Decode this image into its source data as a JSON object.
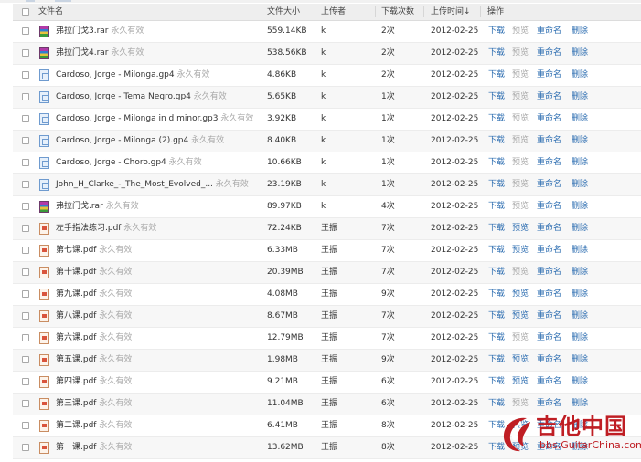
{
  "header": {
    "name": "文件名",
    "size": "文件大小",
    "uploader": "上传者",
    "downloads": "下载次数",
    "time": "上传时间↓",
    "actions": "操作"
  },
  "actions": {
    "download": "下载",
    "preview": "预览",
    "rename": "重命名",
    "delete": "删除"
  },
  "files": [
    {
      "name": "弗拉门戈3.rar",
      "perm": "永久有效",
      "size": "559.14KB",
      "uploader": "k",
      "downloads": "2次",
      "date": "2012-02-25",
      "type": "rar",
      "preview_enabled": false
    },
    {
      "name": "弗拉门戈4.rar",
      "perm": "永久有效",
      "size": "538.56KB",
      "uploader": "k",
      "downloads": "2次",
      "date": "2012-02-25",
      "type": "rar",
      "preview_enabled": false
    },
    {
      "name": "Cardoso, Jorge - Milonga.gp4",
      "perm": "永久有效",
      "size": "4.86KB",
      "uploader": "k",
      "downloads": "2次",
      "date": "2012-02-25",
      "type": "gp4",
      "preview_enabled": false
    },
    {
      "name": "Cardoso, Jorge - Tema Negro.gp4",
      "perm": "永久有效",
      "size": "5.65KB",
      "uploader": "k",
      "downloads": "1次",
      "date": "2012-02-25",
      "type": "gp4",
      "preview_enabled": false
    },
    {
      "name": "Cardoso, Jorge - Milonga in d minor.gp3",
      "perm": "永久有效",
      "size": "3.92KB",
      "uploader": "k",
      "downloads": "1次",
      "date": "2012-02-25",
      "type": "gp4",
      "preview_enabled": false
    },
    {
      "name": "Cardoso, Jorge - Milonga (2).gp4",
      "perm": "永久有效",
      "size": "8.40KB",
      "uploader": "k",
      "downloads": "1次",
      "date": "2012-02-25",
      "type": "gp4",
      "preview_enabled": false
    },
    {
      "name": "Cardoso, Jorge - Choro.gp4",
      "perm": "永久有效",
      "size": "10.66KB",
      "uploader": "k",
      "downloads": "1次",
      "date": "2012-02-25",
      "type": "gp4",
      "preview_enabled": false
    },
    {
      "name": "John_H_Clarke_-_The_Most_Evolved_...",
      "perm": "永久有效",
      "size": "23.19KB",
      "uploader": "k",
      "downloads": "1次",
      "date": "2012-02-25",
      "type": "gp4",
      "preview_enabled": false
    },
    {
      "name": "弗拉门戈.rar",
      "perm": "永久有效",
      "size": "89.97KB",
      "uploader": "k",
      "downloads": "4次",
      "date": "2012-02-25",
      "type": "rar",
      "preview_enabled": false
    },
    {
      "name": "左手指法练习.pdf",
      "perm": "永久有效",
      "size": "72.24KB",
      "uploader": "王振",
      "downloads": "7次",
      "date": "2012-02-25",
      "type": "pdf",
      "preview_enabled": true
    },
    {
      "name": "第七课.pdf",
      "perm": "永久有效",
      "size": "6.33MB",
      "uploader": "王振",
      "downloads": "7次",
      "date": "2012-02-25",
      "type": "pdf",
      "preview_enabled": true
    },
    {
      "name": "第十课.pdf",
      "perm": "永久有效",
      "size": "20.39MB",
      "uploader": "王振",
      "downloads": "7次",
      "date": "2012-02-25",
      "type": "pdf",
      "preview_enabled": false
    },
    {
      "name": "第九课.pdf",
      "perm": "永久有效",
      "size": "4.08MB",
      "uploader": "王振",
      "downloads": "9次",
      "date": "2012-02-25",
      "type": "pdf",
      "preview_enabled": true
    },
    {
      "name": "第八课.pdf",
      "perm": "永久有效",
      "size": "8.67MB",
      "uploader": "王振",
      "downloads": "7次",
      "date": "2012-02-25",
      "type": "pdf",
      "preview_enabled": true
    },
    {
      "name": "第六课.pdf",
      "perm": "永久有效",
      "size": "12.79MB",
      "uploader": "王振",
      "downloads": "7次",
      "date": "2012-02-25",
      "type": "pdf",
      "preview_enabled": false
    },
    {
      "name": "第五课.pdf",
      "perm": "永久有效",
      "size": "1.98MB",
      "uploader": "王振",
      "downloads": "9次",
      "date": "2012-02-25",
      "type": "pdf",
      "preview_enabled": true
    },
    {
      "name": "第四课.pdf",
      "perm": "永久有效",
      "size": "9.21MB",
      "uploader": "王振",
      "downloads": "6次",
      "date": "2012-02-25",
      "type": "pdf",
      "preview_enabled": true
    },
    {
      "name": "第三课.pdf",
      "perm": "永久有效",
      "size": "11.04MB",
      "uploader": "王振",
      "downloads": "6次",
      "date": "2012-02-25",
      "type": "pdf",
      "preview_enabled": false
    },
    {
      "name": "第二课.pdf",
      "perm": "永久有效",
      "size": "6.41MB",
      "uploader": "王振",
      "downloads": "8次",
      "date": "2012-02-25",
      "type": "pdf",
      "preview_enabled": true
    },
    {
      "name": "第一课.pdf",
      "perm": "永久有效",
      "size": "13.62MB",
      "uploader": "王振",
      "downloads": "8次",
      "date": "2012-02-25",
      "type": "pdf",
      "preview_enabled": true
    }
  ],
  "watermark": {
    "text": "吉他中国",
    "url": "bbs.GuitarChina.com"
  },
  "colors": {
    "link": "#2b6cb0",
    "disabled_link": "#a7a7a7",
    "logo_red": "#bf1e24"
  }
}
